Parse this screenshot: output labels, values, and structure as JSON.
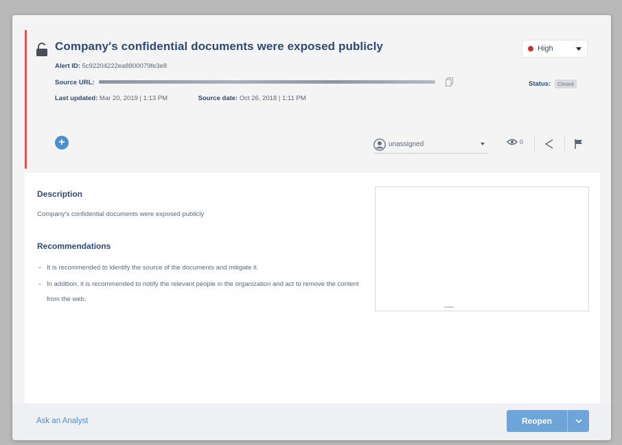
{
  "alert": {
    "title": "Company's confidential documents were exposed publicly",
    "alert_id_label": "Alert ID:",
    "alert_id": "5c92204222ea8800079fe3e8",
    "source_url_label": "Source URL:",
    "last_updated_label": "Last updated:",
    "last_updated": "Mar 20, 2019 | 1:13 PM",
    "source_date_label": "Source date:",
    "source_date": "Oct 26, 2018 | 1:11 PM",
    "severity": "High",
    "status_label": "Status:",
    "status": "Closed"
  },
  "toolbar": {
    "assignee": "unassigned",
    "watch_count": "0",
    "add_icon": "plus-icon",
    "share_icon": "share-icon",
    "flag_icon": "flag-icon"
  },
  "content": {
    "description_title": "Description",
    "description": "Company's confidential documents were exposed publicly",
    "recommendations_title": "Recommendations",
    "recommendations": [
      "It is recommended to identify the source of the documents and mitigate it.",
      "In addition, it is recommended to notify the relevant people in the organization and act to remove the content from the web."
    ]
  },
  "footer": {
    "ask_analyst": "Ask an Analyst",
    "reopen": "Reopen"
  },
  "colors": {
    "accent": "#4b8fd0",
    "severity_high": "#d32f2f",
    "title": "#2c4a73",
    "alert_bar": "#d9534f"
  }
}
